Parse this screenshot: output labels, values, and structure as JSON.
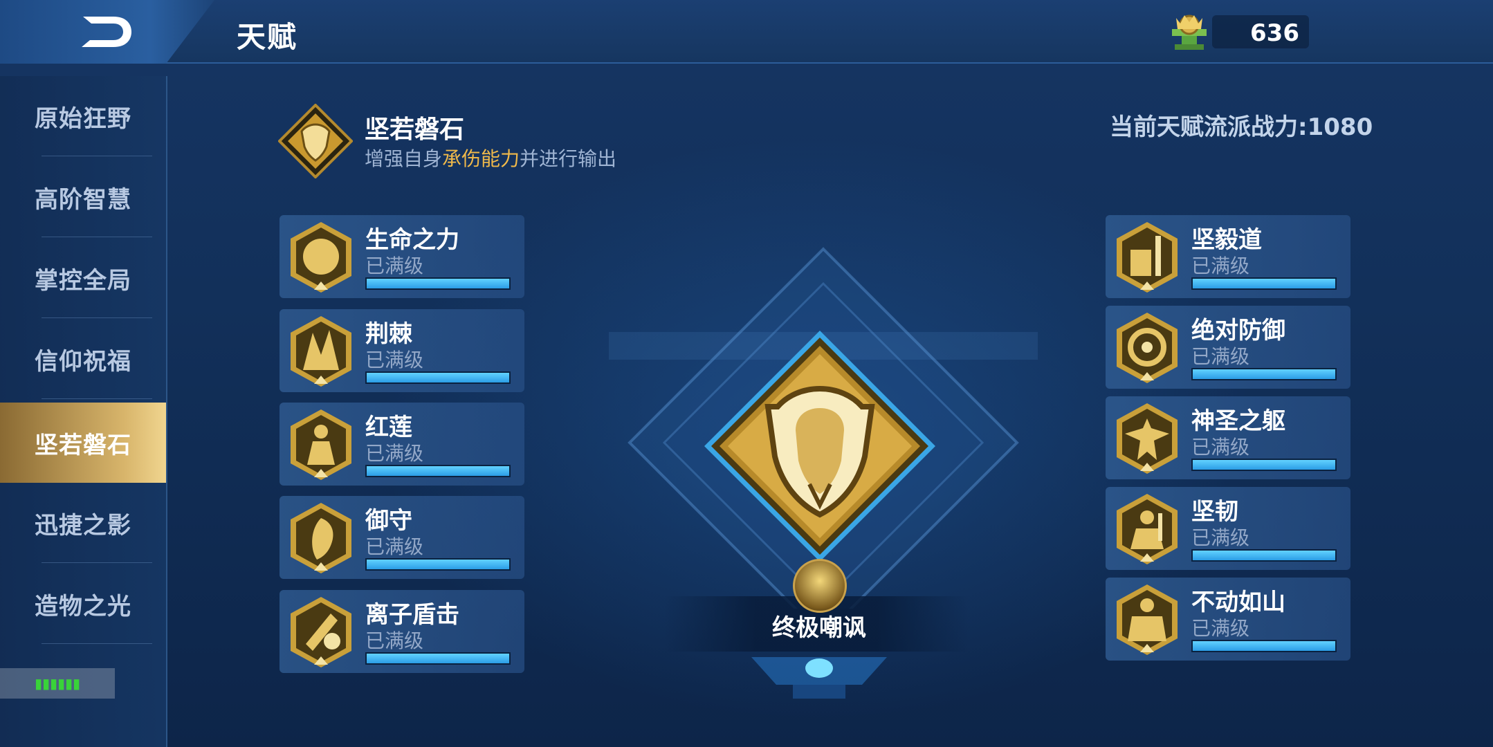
{
  "header": {
    "title": "天赋"
  },
  "currency": {
    "value": "636",
    "icon": "emblem-currency-icon"
  },
  "sidebar": {
    "items": [
      {
        "label": "原始狂野",
        "active": false
      },
      {
        "label": "高阶智慧",
        "active": false
      },
      {
        "label": "掌控全局",
        "active": false
      },
      {
        "label": "信仰祝福",
        "active": false
      },
      {
        "label": "坚若磐石",
        "active": true
      },
      {
        "label": "迅捷之影",
        "active": false
      },
      {
        "label": "造物之光",
        "active": false
      }
    ]
  },
  "school": {
    "name": "坚若磐石",
    "desc_pre": "增强自身",
    "desc_highlight": "承伤能力",
    "desc_post": "并进行输出",
    "power": "当前天赋流派战力:1080"
  },
  "left_talents": [
    {
      "name": "生命之力",
      "status": "已满级",
      "progress": 1.0
    },
    {
      "name": "荆棘",
      "status": "已满级",
      "progress": 1.0
    },
    {
      "name": "红莲",
      "status": "已满级",
      "progress": 1.0
    },
    {
      "name": "御守",
      "status": "已满级",
      "progress": 1.0
    },
    {
      "name": "离子盾击",
      "status": "已满级",
      "progress": 1.0
    }
  ],
  "right_talents": [
    {
      "name": "坚毅道",
      "status": "已满级",
      "progress": 1.0
    },
    {
      "name": "绝对防御",
      "status": "已满级",
      "progress": 1.0
    },
    {
      "name": "神圣之躯",
      "status": "已满级",
      "progress": 1.0
    },
    {
      "name": "坚韧",
      "status": "已满级",
      "progress": 1.0
    },
    {
      "name": "不动如山",
      "status": "已满级",
      "progress": 1.0
    }
  ],
  "ultimate": {
    "name": "终极嘲讽"
  },
  "colors": {
    "accent_gold": "#f0b94a",
    "bar_blue": "#3fb4f2",
    "active_tab": "#d8b56b"
  }
}
